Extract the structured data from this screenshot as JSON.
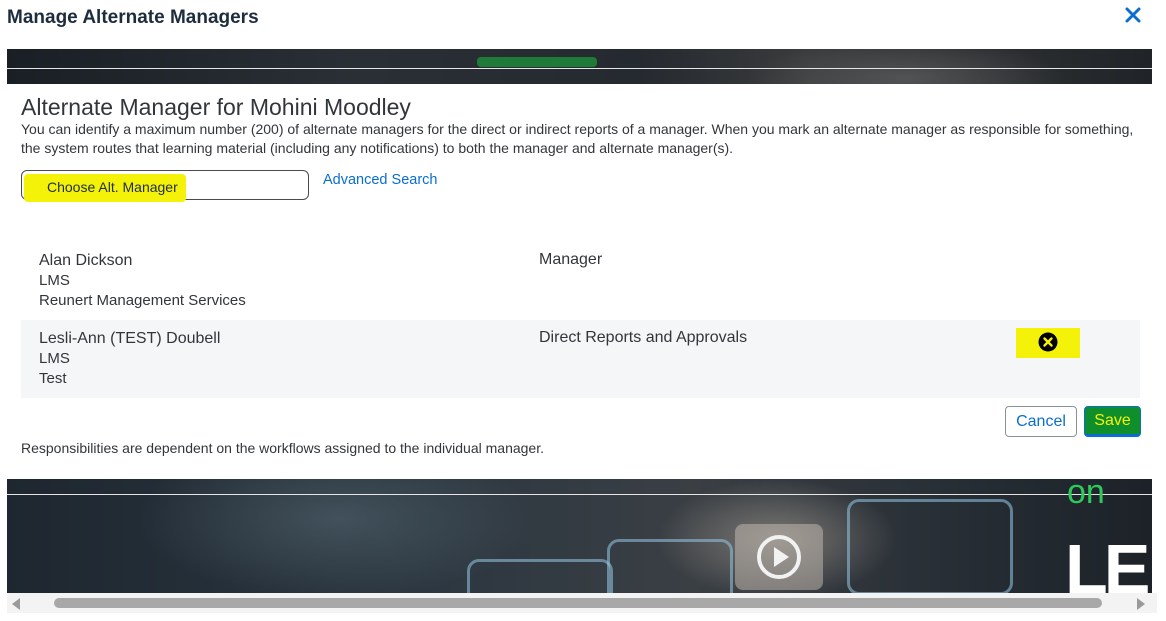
{
  "dialog": {
    "title": "Manage Alternate Managers",
    "close_icon": "close-icon"
  },
  "section": {
    "title": "Alternate Manager for Mohini Moodley",
    "description": "You can identify a maximum number (200) of alternate managers for the direct or indirect reports of a manager. When you mark an alternate manager as responsible for something, the system routes that learning material (including any notifications) to both the manager and alternate manager(s)."
  },
  "picker": {
    "input_label": "Choose Alt. Manager",
    "advanced_search": "Advanced Search"
  },
  "managers": [
    {
      "name": "Alan Dickson",
      "line2": "LMS",
      "line3": "Reunert Management Services",
      "responsibility": "Manager",
      "removable": false
    },
    {
      "name": "Lesli-Ann (TEST) Doubell",
      "line2": "LMS",
      "line3": "Test",
      "responsibility": "Direct Reports and Approvals",
      "removable": true,
      "remove_icon": "remove-circle-icon"
    }
  ],
  "actions": {
    "cancel": "Cancel",
    "save": "Save"
  },
  "footnote": "Responsibilities are dependent on the workflows assigned to the individual manager.",
  "colors": {
    "highlight": "#f5f20a",
    "link": "#0a6ed1",
    "save_bg": "#0f8f2c"
  }
}
